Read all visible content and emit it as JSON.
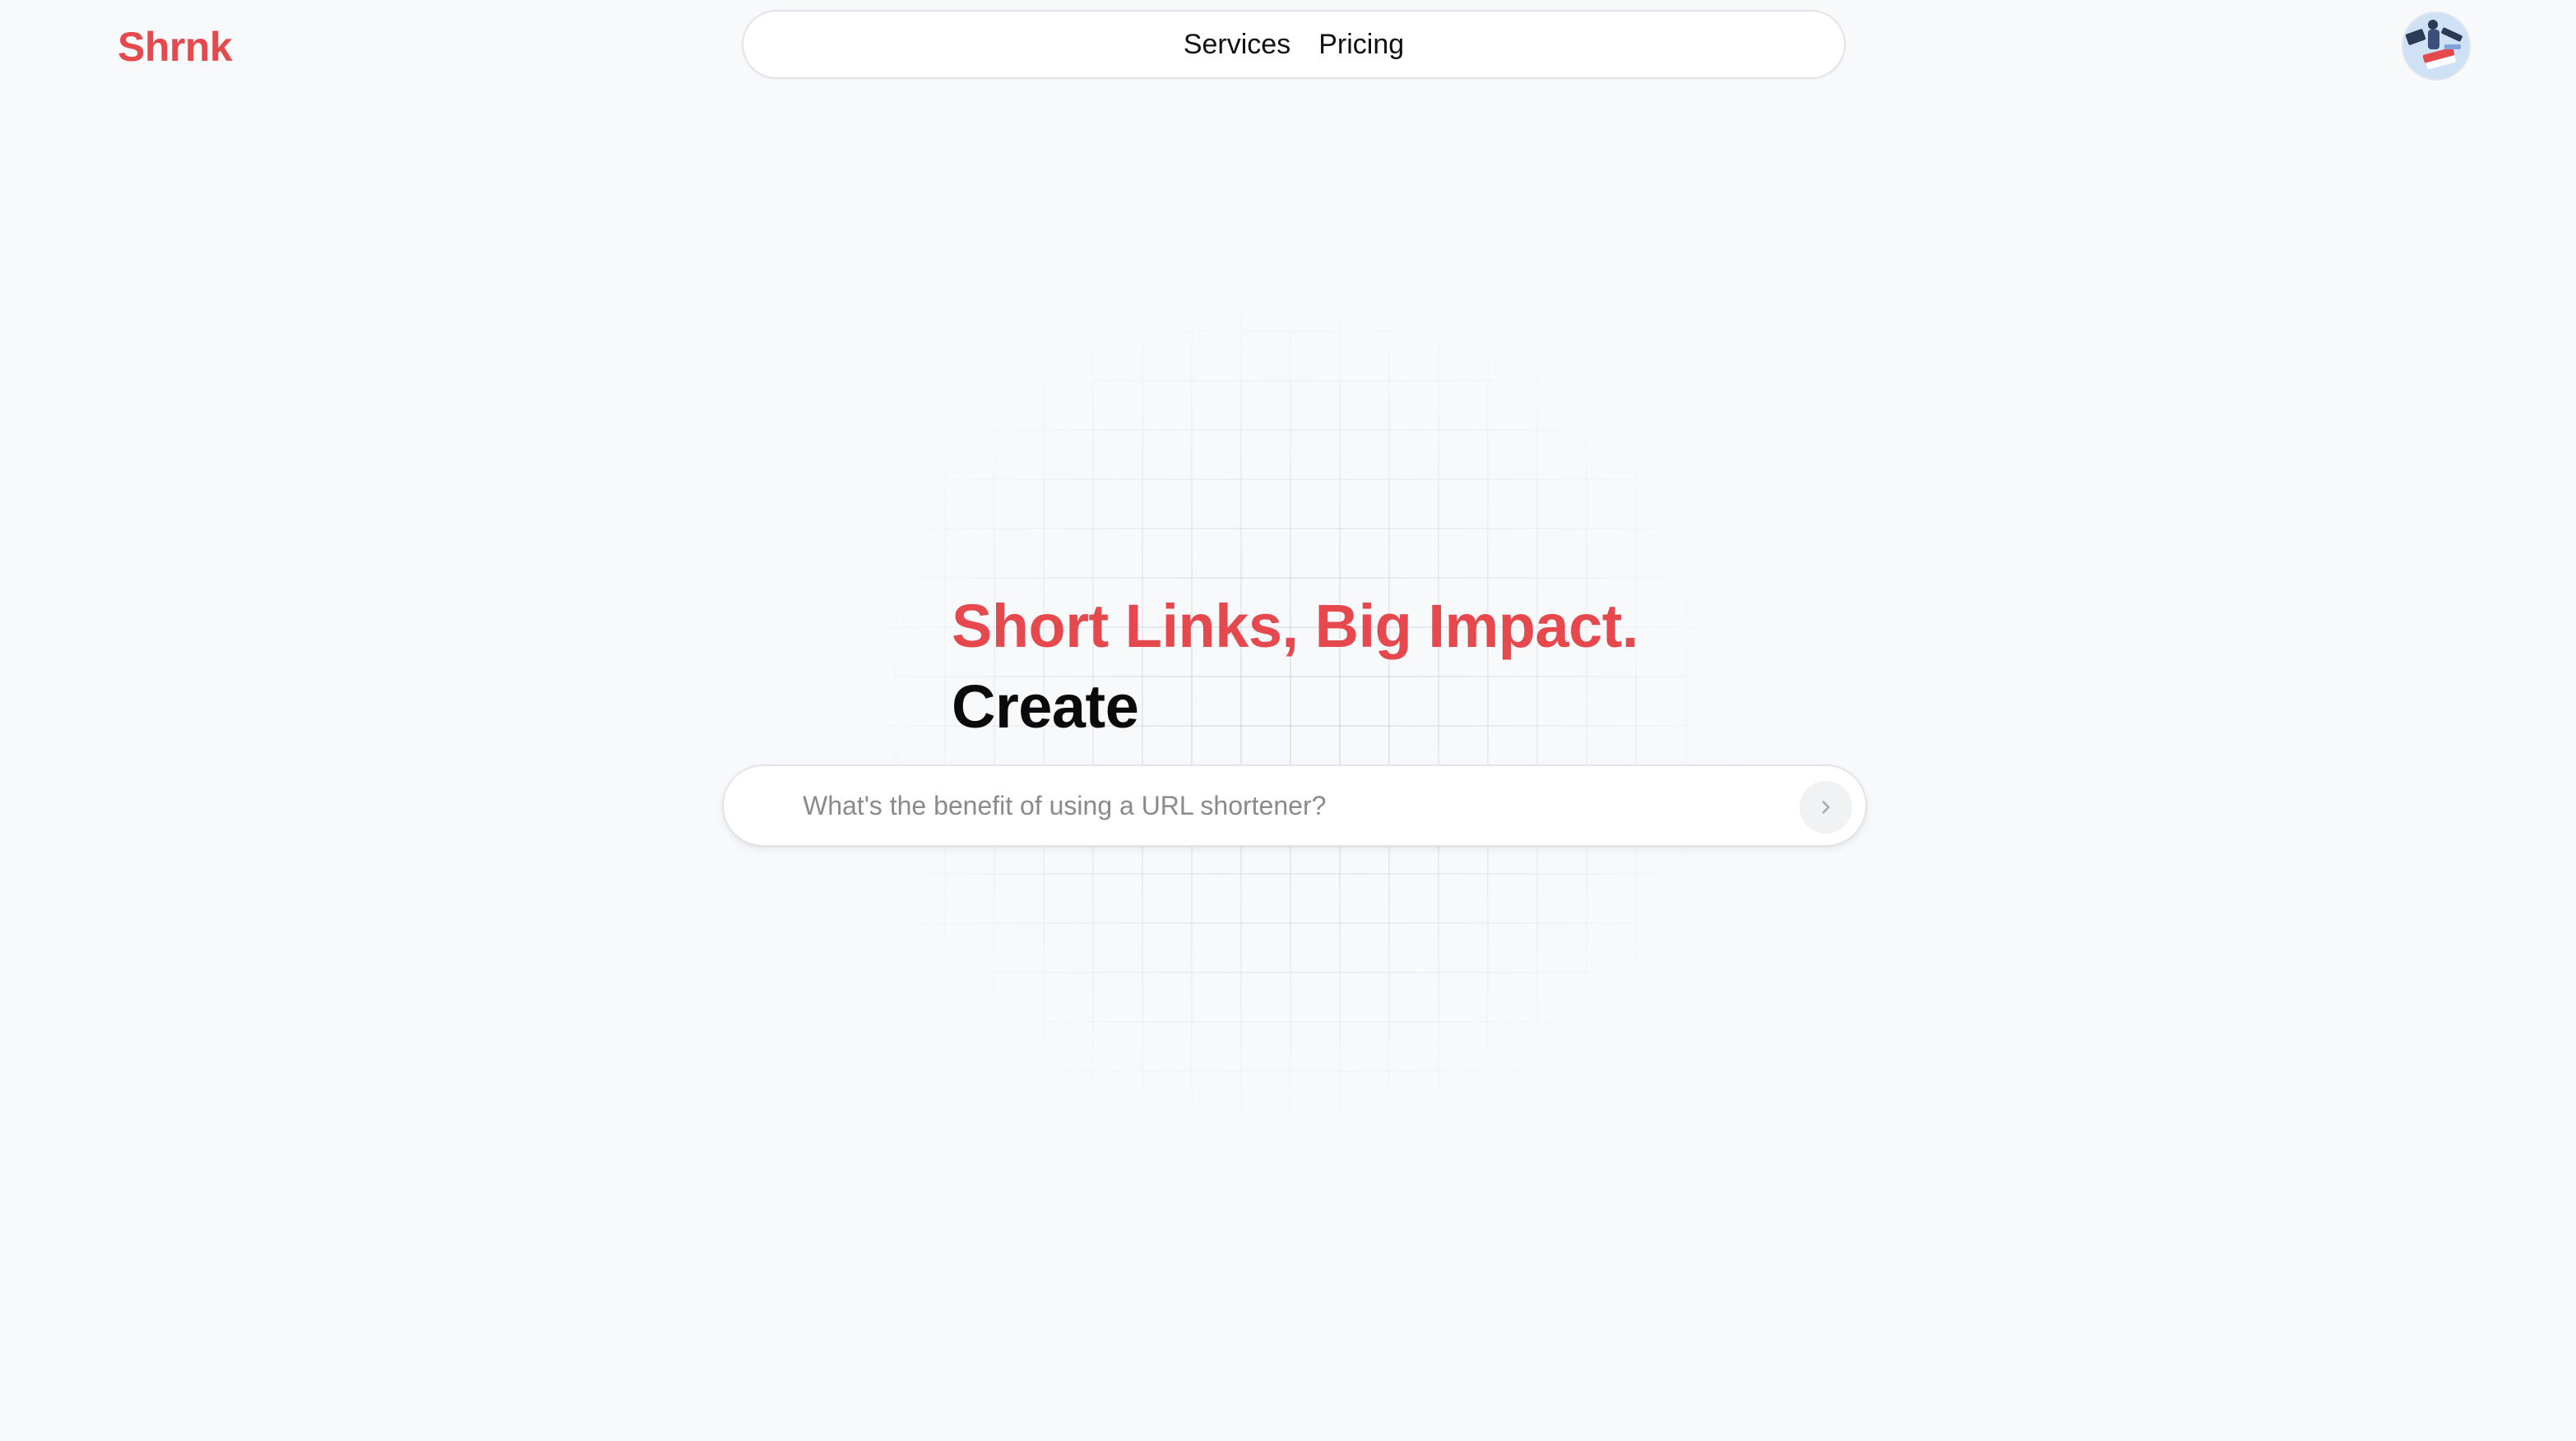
{
  "header": {
    "brand": "Shrnk",
    "nav": [
      {
        "label": "Services"
      },
      {
        "label": "Pricing"
      }
    ]
  },
  "hero": {
    "headline": "Short Links, Big Impact.",
    "subline": "Create"
  },
  "search": {
    "placeholder": "What's the benefit of using a URL shortener?",
    "value": ""
  },
  "icons": {
    "submit": "chevron-right-icon",
    "avatar": "user-avatar-illustration"
  },
  "colors": {
    "brand": "#e5484d",
    "background": "#f8f9fb",
    "text": "#0a0a0a"
  }
}
